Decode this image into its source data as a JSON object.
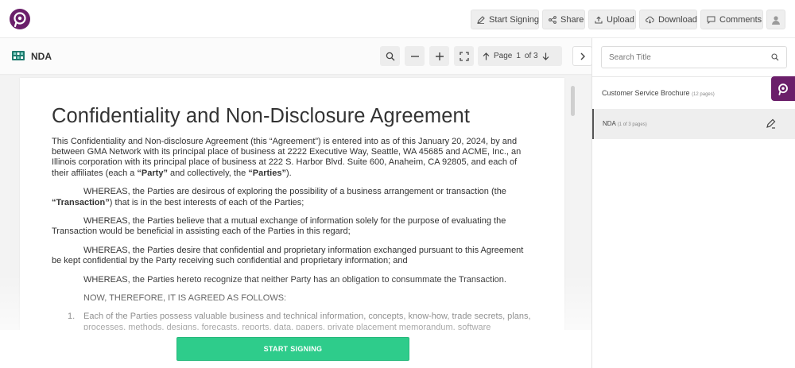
{
  "toolbar": {
    "start_signing": "Start Signing",
    "share": "Share",
    "upload": "Upload",
    "download": "Download",
    "comments": "Comments"
  },
  "document_header": {
    "doc_name": "NDA",
    "page_label": "Page",
    "current_page": "1",
    "of_label": "of 3"
  },
  "document": {
    "title": "Confidentiality and Non-Disclosure Agreement",
    "intro_a": "This Confidentiality and Non-disclosure Agreement (this “Agreement”) is entered into as of this January 20, 2024, by and between GMA Network with its principal place of business at 2222 Executive Way, Seattle, WA 45685 and ACME, Inc., an Illinois corporation with its principal place of business at 222 S. Harbor Blvd. Suite 600, Anaheim, CA 92805, and each of their affiliates (each a ",
    "intro_party": "“Party”",
    "intro_b": " and collectively, the ",
    "intro_parties": "“Parties”",
    "intro_c": ").",
    "whereas1_a": "WHEREAS, the Parties are desirous of exploring the possibility of a business arrangement or transaction (the ",
    "whereas1_term": "“Transaction”",
    "whereas1_b": ") that is in the best interests of each of the Parties;",
    "whereas2": "WHEREAS, the Parties believe that a mutual exchange of information solely for the purpose of evaluating the Transaction would be beneficial in assisting each of the Parties in this regard;",
    "whereas3": "WHEREAS, the Parties desire that confidential and proprietary information exchanged pursuant to this Agreement be kept confidential by the Party receiving such confidential and proprietary information; and",
    "whereas4": "WHEREAS, the Parties hereto recognize that neither Party has an obligation to consummate the Transaction.",
    "now_therefore": "NOW, THEREFORE, IT IS AGREED AS FOLLOWS:",
    "item1_num": "1.",
    "item1_text": "Each of the Parties possess valuable business and technical information, concepts, know-how, trade secrets, plans, processes, methods, designs, forecasts, reports, data, papers, private placement memorandum, software"
  },
  "footer": {
    "start_signing": "START SIGNING"
  },
  "sidebar": {
    "search_placeholder": "Search Title",
    "documents": [
      {
        "name": "Customer Service Brochure",
        "pages": "(12 pages)"
      },
      {
        "name": "NDA",
        "pages": "(1 of 3 pages)"
      }
    ]
  },
  "colors": {
    "brand": "#6b1f6a",
    "accent_green": "#2ecc8b"
  }
}
